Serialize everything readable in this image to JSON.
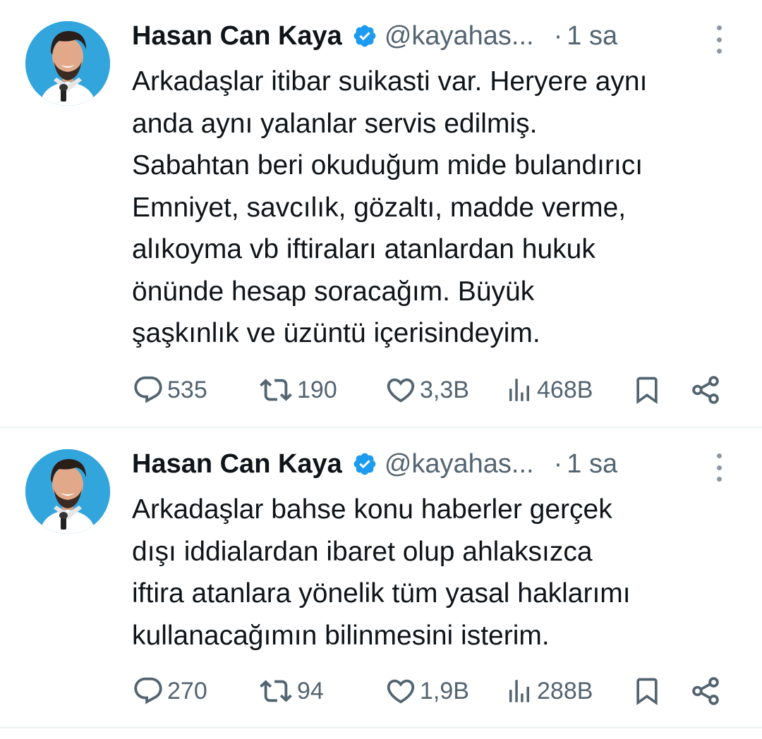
{
  "tweets": [
    {
      "author_name": "Hasan Can Kaya",
      "handle": "@kayahas...",
      "separator": "·",
      "time": "1 sa",
      "text": "Arkadaşlar itibar suikasti var. Heryere aynı\nanda aynı yalanlar servis edilmiş.\nSabahtan beri okuduğum mide bulandırıcı\nEmniyet, savcılık, gözaltı, madde verme,\nalıkoyma vb iftiraları atanlardan hukuk\nönünde hesap soracağım. Büyük\nşaşkınlık ve üzüntü içerisindeyim.",
      "stats": {
        "replies": "535",
        "retweets": "190",
        "likes": "3,3B",
        "views": "468B"
      }
    },
    {
      "author_name": "Hasan Can Kaya",
      "handle": "@kayahas...",
      "separator": "·",
      "time": "1 sa",
      "text": "Arkadaşlar bahse konu haberler gerçek\ndışı iddialardan ibaret olup ahlaksızca\niftira atanlara yönelik tüm yasal haklarımı\nkullanacağımın bilinmesini isterim.",
      "stats": {
        "replies": "270",
        "retweets": "94",
        "likes": "1,9B",
        "views": "288B"
      }
    }
  ],
  "icons": {
    "verified": "verified-badge-icon",
    "more": "more-vertical-icon",
    "reply": "reply-bubble-icon",
    "retweet": "retweet-arrows-icon",
    "like": "heart-icon",
    "views": "bar-chart-icon",
    "bookmark": "bookmark-icon",
    "share": "share-icon"
  },
  "colors": {
    "text_primary": "#0f1419",
    "text_secondary": "#536471",
    "verified_blue": "#1d9bf0",
    "avatar_background": "#33a5dd",
    "divider": "#eff3f4"
  }
}
